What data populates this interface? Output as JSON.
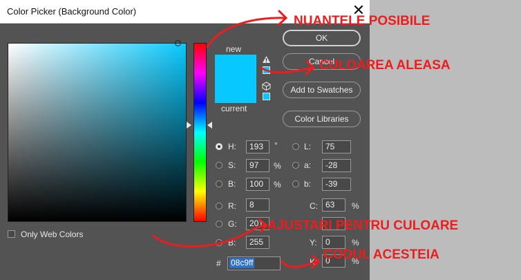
{
  "window": {
    "title": "Color Picker (Background Color)",
    "close_glyph": "✕"
  },
  "buttons": {
    "ok": "OK",
    "cancel": "Cancel",
    "add_swatches": "Add to Swatches",
    "color_libraries": "Color Libraries"
  },
  "swatch": {
    "new_label": "new",
    "current_label": "current",
    "color": "#08c9ff"
  },
  "icons": {
    "warning": "warning-triangle-icon",
    "cube": "web-safe-cube-icon"
  },
  "hsb": [
    {
      "label": "H:",
      "value": "193",
      "unit": "°",
      "selected": true
    },
    {
      "label": "S:",
      "value": "97",
      "unit": "%",
      "selected": false
    },
    {
      "label": "B:",
      "value": "100",
      "unit": "%",
      "selected": false
    }
  ],
  "lab": [
    {
      "label": "L:",
      "value": "75"
    },
    {
      "label": "a:",
      "value": "-28"
    },
    {
      "label": "b:",
      "value": "-39"
    }
  ],
  "rgb": [
    {
      "label": "R:",
      "value": "8"
    },
    {
      "label": "G:",
      "value": "201"
    },
    {
      "label": "B:",
      "value": "255"
    }
  ],
  "cmyk": [
    {
      "label": "C:",
      "value": "63",
      "unit": "%"
    },
    {
      "label": "M:",
      "value": "",
      "unit": "%"
    },
    {
      "label": "Y:",
      "value": "0",
      "unit": "%"
    },
    {
      "label": "K:",
      "value": "0",
      "unit": "%"
    }
  ],
  "hex": {
    "prefix": "#",
    "value": "08c9ff"
  },
  "web_colors_label": "Only Web Colors",
  "annotations": {
    "nuantele": "NUANTELE POSIBILE",
    "culoarea": "CULOAREA ALEASA",
    "ajustari": "AJUSTARI PENTRU CULOARE",
    "codul": "CODUL ACESTEIA",
    "color": "#ee1c1c"
  }
}
